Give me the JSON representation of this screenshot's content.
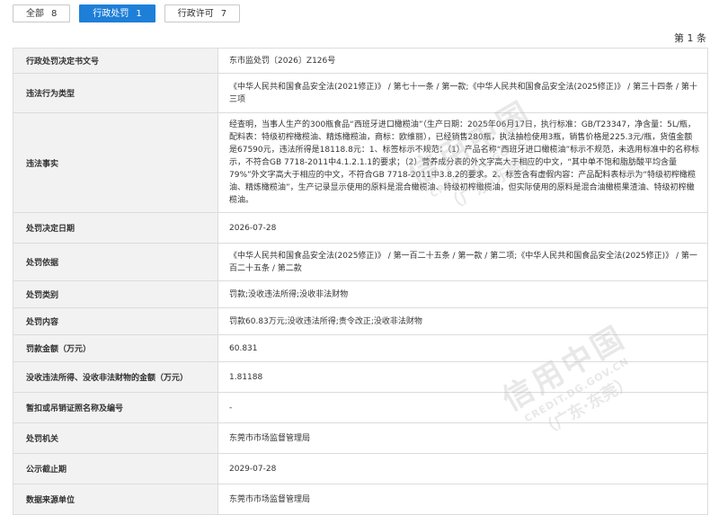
{
  "tabs": [
    {
      "label": "全部",
      "count": "8"
    },
    {
      "label": "行政处罚",
      "count": "1"
    },
    {
      "label": "行政许可",
      "count": "7"
    }
  ],
  "page_indicator": "第 1 条",
  "rows": [
    {
      "label": "行政处罚决定书文号",
      "value": "东市监处罚〔2026〕Z126号"
    },
    {
      "label": "违法行为类型",
      "value": "《中华人民共和国食品安全法(2021修正)》 / 第七十一条 / 第一款;《中华人民共和国食品安全法(2025修正)》 / 第三十四条 / 第十三项"
    },
    {
      "label": "违法事实",
      "value": "经查明，当事人生产的300瓶食品“西班牙进口橄榄油”（生产日期：2025年06月17日，执行标准：GB/T23347，净含量：5L/瓶，配料表：特级初榨橄榄油、精炼橄榄油，商标：欧维丽），已经销售280瓶，执法抽检使用3瓶，销售价格是225.3元/瓶，货值金额是67590元，违法所得是18118.8元：1、标签标示不规范：（1）产品名称“西班牙进口橄榄油”标示不规范，未选用标准中的名称标示，不符合GB 7718-2011中4.1.2.1.1的要求；（2）营养成分表的外文字高大于相应的中文，“其中单不饱和脂肪酸平均含量79%”外文字高大于相应的中文，不符合GB 7718-2011中3.8.2的要求。2、标签含有虚假内容：产品配料表标示为“特级初榨橄榄油、精炼橄榄油”，生产记录显示使用的原料是混合橄榄油、特级初榨橄榄油，但实际使用的原料是混合油橄榄果渣油、特级初榨橄榄油。"
    },
    {
      "label": "处罚决定日期",
      "value": "2026-07-28"
    },
    {
      "label": "处罚依据",
      "value": "《中华人民共和国食品安全法(2025修正)》 / 第一百二十五条 / 第一款 / 第二项;《中华人民共和国食品安全法(2025修正)》 / 第一百二十五条 / 第二款"
    },
    {
      "label": "处罚类别",
      "value": "罚款;没收违法所得;没收非法财物"
    },
    {
      "label": "处罚内容",
      "value": "罚款60.83万元;没收违法所得;责令改正;没收非法财物"
    },
    {
      "label": "罚款金额（万元）",
      "value": "60.831"
    },
    {
      "label": "没收违法所得、没收非法财物的金额（万元）",
      "value": "1.81188"
    },
    {
      "label": "暂扣或吊销证照名称及编号",
      "value": "-"
    },
    {
      "label": "处罚机关",
      "value": "东莞市市场监督管理局"
    },
    {
      "label": "公示截止期",
      "value": "2029-07-28"
    },
    {
      "label": "数据来源单位",
      "value": "东莞市市场监督管理局"
    }
  ],
  "watermark": {
    "line1": "信用中国",
    "line2": "CREDIT.DG.GOV.CN",
    "line3": "（广东·东莞）"
  }
}
